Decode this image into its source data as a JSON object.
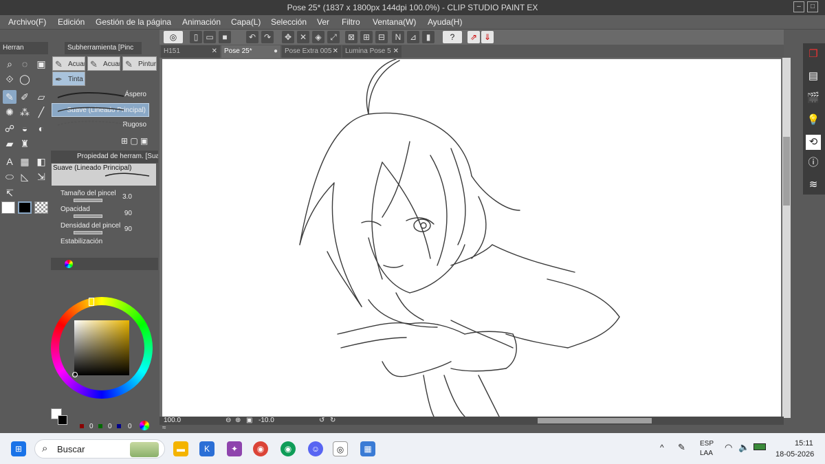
{
  "window": {
    "title": "Pose 25* (1837 x 1800px 144dpi 100.0%) - CLIP STUDIO PAINT EX"
  },
  "menu": [
    "Archivo(F)",
    "Edición",
    "Gestión de la página",
    "Animación",
    "Capa(L)",
    "Selección",
    "Ver",
    "Filtro",
    "Ventana(W)",
    "Ayuda(H)"
  ],
  "panels": {
    "tools_header": "Herran",
    "subtool_header": "Subherramienta [Pinc",
    "subtools": [
      "Acuar",
      "Acuar",
      "Pintur",
      "Tinta"
    ],
    "brushes": [
      "Áspero",
      "Suave (Lineado Principal)",
      "Rugoso"
    ],
    "property_header": "Propiedad de herram. [Suav",
    "property_brush": "Suave (Lineado Principal)",
    "properties": [
      {
        "label": "Tamaño del pincel",
        "value": "3.0"
      },
      {
        "label": "Opacidad",
        "value": "90"
      },
      {
        "label": "Densidad del pincel",
        "value": "90"
      },
      {
        "label": "Estabilización",
        "value": ""
      }
    ],
    "color_values": [
      "0",
      "0",
      "0"
    ]
  },
  "tabs": [
    {
      "label": "H151",
      "active": false
    },
    {
      "label": "Pose 25*",
      "active": true
    },
    {
      "label": "Pose Extra 005",
      "active": false
    },
    {
      "label": "Lumina Pose 5",
      "active": false
    }
  ],
  "status": {
    "zoom": "100.0",
    "angle": "-10.0"
  },
  "taskbar": {
    "search_placeholder": "Buscar",
    "lang_top": "ESP",
    "lang_bottom": "LAA",
    "time": "15:11",
    "date": "18-05-2026"
  },
  "colors": {
    "accent": "#8aa8c6",
    "panel": "#5a5a5a"
  }
}
